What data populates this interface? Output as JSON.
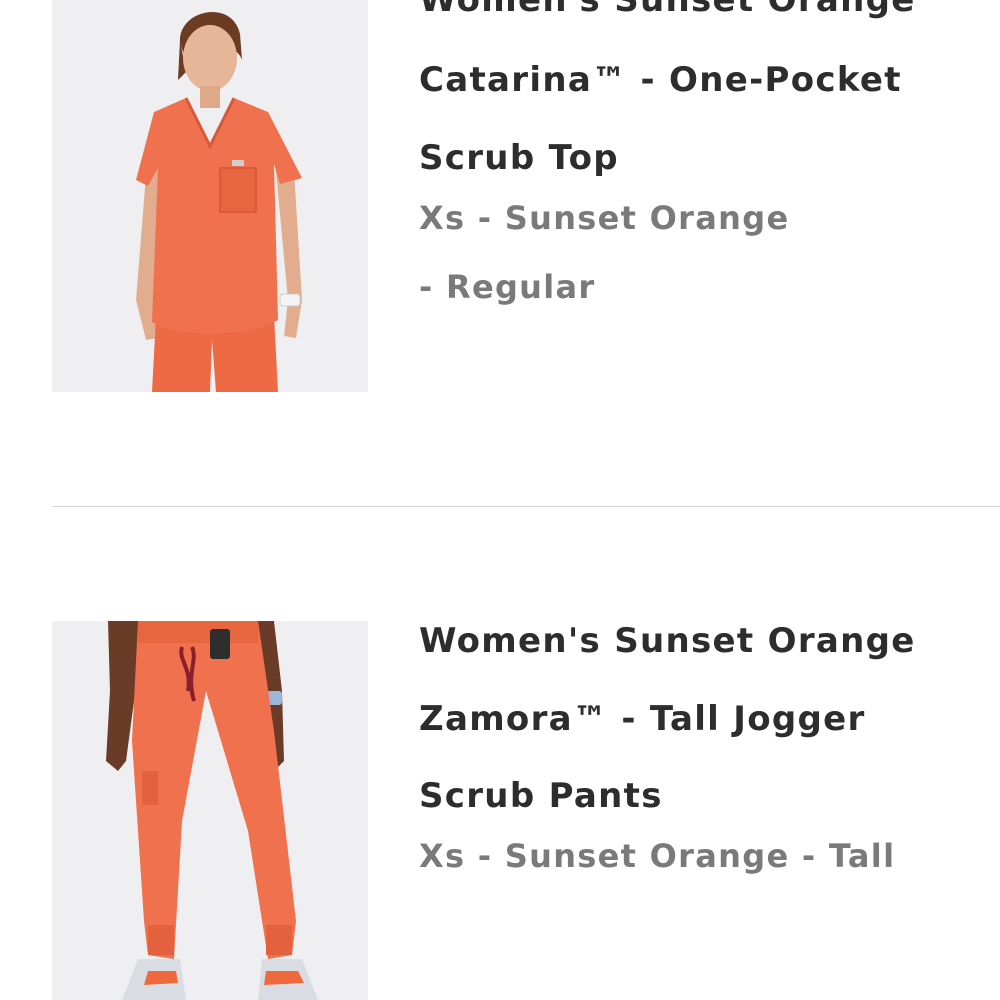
{
  "cart": {
    "items": [
      {
        "title_lines": [
          "Women's Sunset Orange",
          "Catarina™ - One-Pocket",
          "Scrub Top"
        ],
        "variant_lines": [
          "Xs - Sunset Orange",
          "- Regular"
        ],
        "image_icon": "scrub-top-product-photo",
        "product_color": "#f0714d"
      },
      {
        "title_lines": [
          "Women's Sunset Orange",
          "Zamora™ - Tall Jogger",
          "Scrub Pants"
        ],
        "variant_lines": [
          "Xs - Sunset Orange - Tall"
        ],
        "image_icon": "scrub-pants-product-photo",
        "product_color": "#f0714d"
      }
    ]
  },
  "colors": {
    "title": "#2d2d2d",
    "variant": "#7a7a7a",
    "divider": "#d6d6d6",
    "photo_background": "#efeff1"
  }
}
